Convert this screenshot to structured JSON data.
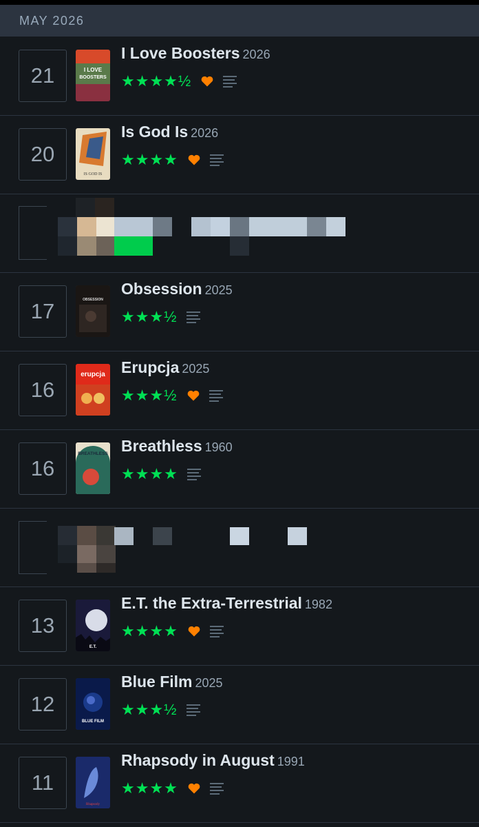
{
  "header": {
    "month": "MAY 2026"
  },
  "colors": {
    "star": "#00e054",
    "heart": "#ff8000",
    "panel": "#2c3440"
  },
  "entries": [
    {
      "day": "21",
      "title": "I Love Boosters",
      "year": "2026",
      "stars": "★★★★½",
      "liked": true,
      "review": true,
      "poster": "i-love-boosters-poster"
    },
    {
      "day": "20",
      "title": "Is God Is",
      "year": "2026",
      "stars": "★★★★",
      "liked": true,
      "review": true,
      "poster": "is-god-is-poster"
    },
    {
      "redacted": true
    },
    {
      "day": "17",
      "title": "Obsession",
      "year": "2025",
      "stars": "★★★½",
      "liked": false,
      "review": true,
      "poster": "obsession-poster"
    },
    {
      "day": "16",
      "title": "Erupcja",
      "year": "2025",
      "stars": "★★★½",
      "liked": true,
      "review": true,
      "poster": "erupcja-poster"
    },
    {
      "day": "16",
      "title": "Breathless",
      "year": "1960",
      "stars": "★★★★",
      "liked": false,
      "review": true,
      "poster": "breathless-poster"
    },
    {
      "redacted": true
    },
    {
      "day": "13",
      "title": "E.T. the Extra-Terrestrial",
      "year": "1982",
      "stars": "★★★★",
      "liked": true,
      "review": true,
      "poster": "et-poster"
    },
    {
      "day": "12",
      "title": "Blue Film",
      "year": "2025",
      "stars": "★★★½",
      "liked": false,
      "review": true,
      "poster": "blue-film-poster"
    },
    {
      "day": "11",
      "title": "Rhapsody in August",
      "year": "1991",
      "stars": "★★★★",
      "liked": true,
      "review": true,
      "poster": "rhapsody-in-august-poster"
    }
  ]
}
